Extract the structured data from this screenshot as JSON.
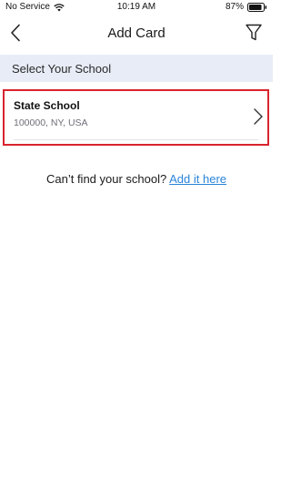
{
  "status_bar": {
    "carrier": "No Service",
    "time": "10:19 AM",
    "battery": "87%"
  },
  "nav": {
    "title": "Add Card",
    "icons": {
      "back": "chevron-left-icon",
      "filter": "filter-icon"
    }
  },
  "section": {
    "header": "Select Your School"
  },
  "schools": [
    {
      "name": "State School",
      "address": "100000, NY, USA"
    }
  ],
  "footer": {
    "prompt": "Can’t find your school?",
    "link": "Add it here"
  },
  "colors": {
    "section_bg": "#e8ecf6",
    "highlight_border": "#d8242e",
    "link": "#2a84d8"
  }
}
